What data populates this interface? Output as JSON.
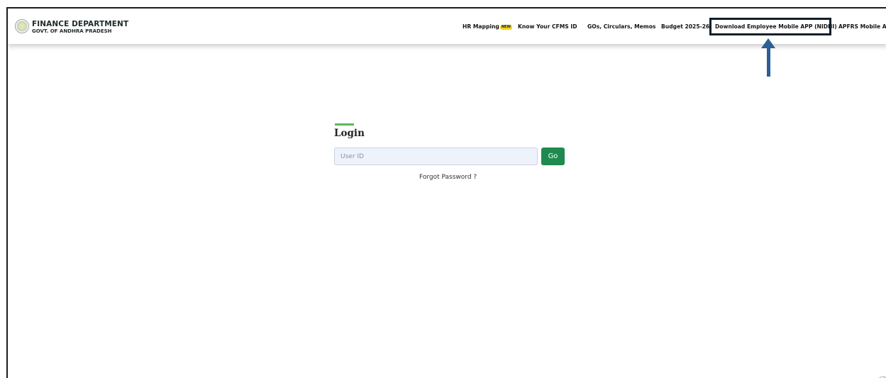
{
  "header": {
    "brand_title": "FINANCE DEPARTMENT",
    "brand_subtitle": "GOVT. OF ANDHRA PRADESH",
    "nav": [
      {
        "label": "HR Mapping",
        "badge": "NEW"
      },
      {
        "label": "Know Your CFMS ID"
      },
      {
        "label": "GOs, Circulars, Memos"
      },
      {
        "label": "Budget 2025-26"
      },
      {
        "label": "Download Employee Mobile APP (NIDHI)"
      },
      {
        "label": "APFRS Mobile APP"
      }
    ]
  },
  "login": {
    "title": "Login",
    "user_placeholder": "User ID",
    "user_value": "",
    "go_label": "Go",
    "forgot_label": "Forgot Password ?"
  },
  "colors": {
    "accent_green": "#1f8a4f",
    "title_bar": "#5cb85c",
    "annotation_blue": "#2b5f96",
    "badge_yellow": "#f1d21f"
  },
  "icons": {
    "logo": "emblem-icon",
    "annotation": "up-arrow-icon",
    "corner": "decorative-swirl-icon"
  }
}
